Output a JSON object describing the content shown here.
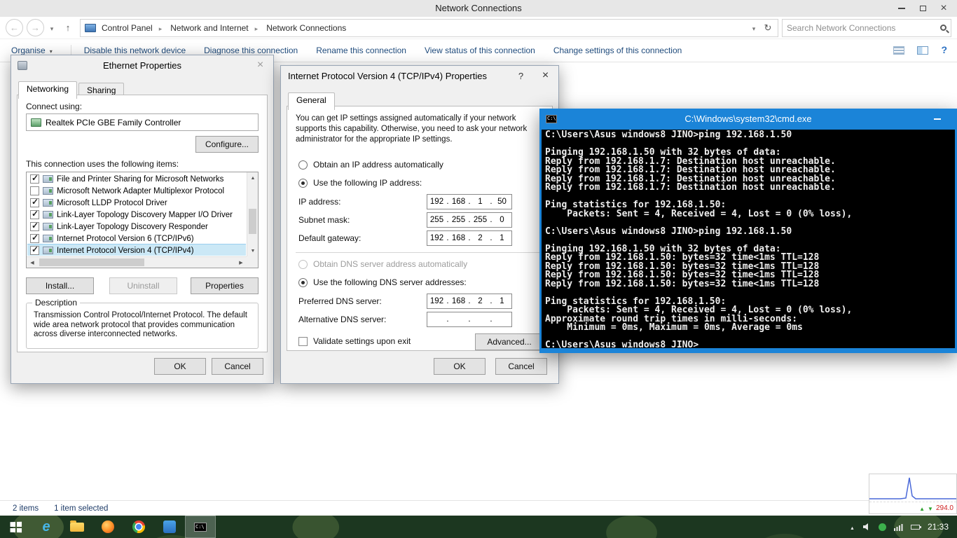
{
  "explorer": {
    "title": "Network Connections",
    "breadcrumb": [
      "Control Panel",
      "Network and Internet",
      "Network Connections"
    ],
    "search_placeholder": "Search Network Connections",
    "toolbar": [
      "Organise",
      "Disable this network device",
      "Diagnose this connection",
      "Rename this connection",
      "View status of this connection",
      "Change settings of this connection"
    ],
    "status": {
      "items": "2 items",
      "selected": "1 item selected"
    }
  },
  "ethernet_dialog": {
    "title": "Ethernet Properties",
    "tabs": [
      "Networking",
      "Sharing"
    ],
    "connect_using_label": "Connect using:",
    "adapter_name": "Realtek PCIe GBE Family Controller",
    "configure_button": "Configure...",
    "items_label": "This connection uses the following items:",
    "items": [
      {
        "label": "File and Printer Sharing for Microsoft Networks",
        "checked": true,
        "selected": false
      },
      {
        "label": "Microsoft Network Adapter Multiplexor Protocol",
        "checked": false,
        "selected": false
      },
      {
        "label": "Microsoft LLDP Protocol Driver",
        "checked": true,
        "selected": false
      },
      {
        "label": "Link-Layer Topology Discovery Mapper I/O Driver",
        "checked": true,
        "selected": false
      },
      {
        "label": "Link-Layer Topology Discovery Responder",
        "checked": true,
        "selected": false
      },
      {
        "label": "Internet Protocol Version 6 (TCP/IPv6)",
        "checked": true,
        "selected": false
      },
      {
        "label": "Internet Protocol Version 4 (TCP/IPv4)",
        "checked": true,
        "selected": true
      }
    ],
    "install_button": "Install...",
    "uninstall_button": "Uninstall",
    "uninstall_disabled": true,
    "properties_button": "Properties",
    "description_title": "Description",
    "description_text": "Transmission Control Protocol/Internet Protocol. The default wide area network protocol that provides communication across diverse interconnected networks.",
    "ok_button": "OK",
    "cancel_button": "Cancel"
  },
  "ipv4_dialog": {
    "title": "Internet Protocol Version 4 (TCP/IPv4) Properties",
    "tab": "General",
    "intro": "You can get IP settings assigned automatically if your network supports this capability. Otherwise, you need to ask your network administrator for the appropriate IP settings.",
    "radios": [
      {
        "label": "Obtain an IP address automatically",
        "selected": false,
        "disabled": false
      },
      {
        "label": "Use the following IP address:",
        "selected": true,
        "disabled": false
      },
      {
        "label": "Obtain DNS server address automatically",
        "selected": false,
        "disabled": true
      },
      {
        "label": "Use the following DNS server addresses:",
        "selected": true,
        "disabled": false
      }
    ],
    "fields": [
      {
        "label": "IP address:",
        "octets": [
          "192",
          "168",
          "1",
          "50"
        ]
      },
      {
        "label": "Subnet mask:",
        "octets": [
          "255",
          "255",
          "255",
          "0"
        ]
      },
      {
        "label": "Default gateway:",
        "octets": [
          "192",
          "168",
          "2",
          "1"
        ]
      },
      {
        "label": "Preferred DNS server:",
        "octets": [
          "192",
          "168",
          "2",
          "1"
        ]
      },
      {
        "label": "Alternative DNS server:",
        "octets": [
          "",
          "",
          "",
          ""
        ]
      }
    ],
    "validate_label": "Validate settings upon exit",
    "validate_checked": false,
    "advanced_button": "Advanced...",
    "ok_button": "OK",
    "cancel_button": "Cancel"
  },
  "cmd": {
    "title": "C:\\Windows\\system32\\cmd.exe",
    "lines": [
      "C:\\Users\\Asus windows8 JINO>ping 192.168.1.50",
      "",
      "Pinging 192.168.1.50 with 32 bytes of data:",
      "Reply from 192.168.1.7: Destination host unreachable.",
      "Reply from 192.168.1.7: Destination host unreachable.",
      "Reply from 192.168.1.7: Destination host unreachable.",
      "Reply from 192.168.1.7: Destination host unreachable.",
      "",
      "Ping statistics for 192.168.1.50:",
      "    Packets: Sent = 4, Received = 4, Lost = 0 (0% loss),",
      "",
      "C:\\Users\\Asus windows8 JINO>ping 192.168.1.50",
      "",
      "Pinging 192.168.1.50 with 32 bytes of data:",
      "Reply from 192.168.1.50: bytes=32 time<1ms TTL=128",
      "Reply from 192.168.1.50: bytes=32 time<1ms TTL=128",
      "Reply from 192.168.1.50: bytes=32 time<1ms TTL=128",
      "Reply from 192.168.1.50: bytes=32 time<1ms TTL=128",
      "",
      "Ping statistics for 192.168.1.50:",
      "    Packets: Sent = 4, Received = 4, Lost = 0 (0% loss),",
      "Approximate round trip times in milli-seconds:",
      "    Minimum = 0ms, Maximum = 0ms, Average = 0ms",
      "",
      "C:\\Users\\Asus windows8 JINO>"
    ]
  },
  "taskbar": {
    "clock": "21:33"
  },
  "net_widget": {
    "reading": "294.0"
  },
  "icons": {
    "search-icon": "magnifier",
    "refresh-icon": "circular-arrow",
    "back-icon": "left-arrow",
    "up-icon": "up-arrow",
    "help-icon": "question-mark",
    "windows-logo-icon": "four-pane-flag",
    "cmd-icon": "black-console-C:\\",
    "close-icon": "x-cross"
  }
}
